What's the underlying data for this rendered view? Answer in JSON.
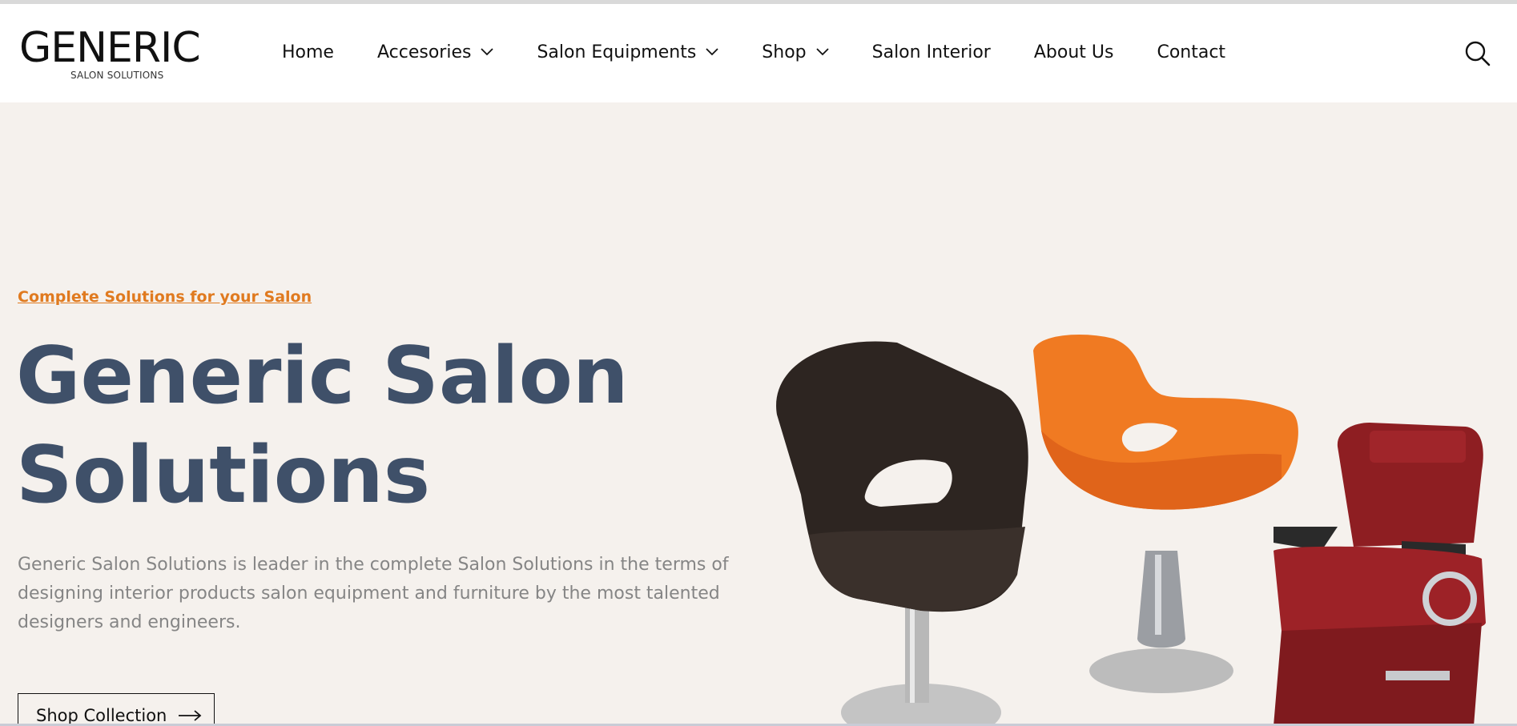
{
  "header": {
    "logo": {
      "main": "GENERIC",
      "sub": "SALON SOLUTIONS"
    },
    "nav": [
      {
        "label": "Home",
        "has_dropdown": false
      },
      {
        "label": "Accesories",
        "has_dropdown": true
      },
      {
        "label": "Salon Equipments",
        "has_dropdown": true
      },
      {
        "label": "Shop",
        "has_dropdown": true
      },
      {
        "label": "Salon Interior",
        "has_dropdown": false
      },
      {
        "label": "About Us",
        "has_dropdown": false
      },
      {
        "label": "Contact",
        "has_dropdown": false
      }
    ],
    "search_icon": "search-icon"
  },
  "hero": {
    "tagline": "Complete Solutions for your Salon",
    "title_line1": "Generic Salon",
    "title_line2": "Solutions",
    "description": "Generic Salon Solutions is leader in the complete Salon Solutions in the terms of designing interior products salon equipment and furniture by the most talented designers and engineers.",
    "cta_label": "Shop Collection",
    "cta_icon": "arrow-right-icon"
  },
  "colors": {
    "accent": "#e07a1f",
    "title": "#3f5069",
    "hero_bg": "#f5f1ed",
    "text_muted": "#858585"
  }
}
